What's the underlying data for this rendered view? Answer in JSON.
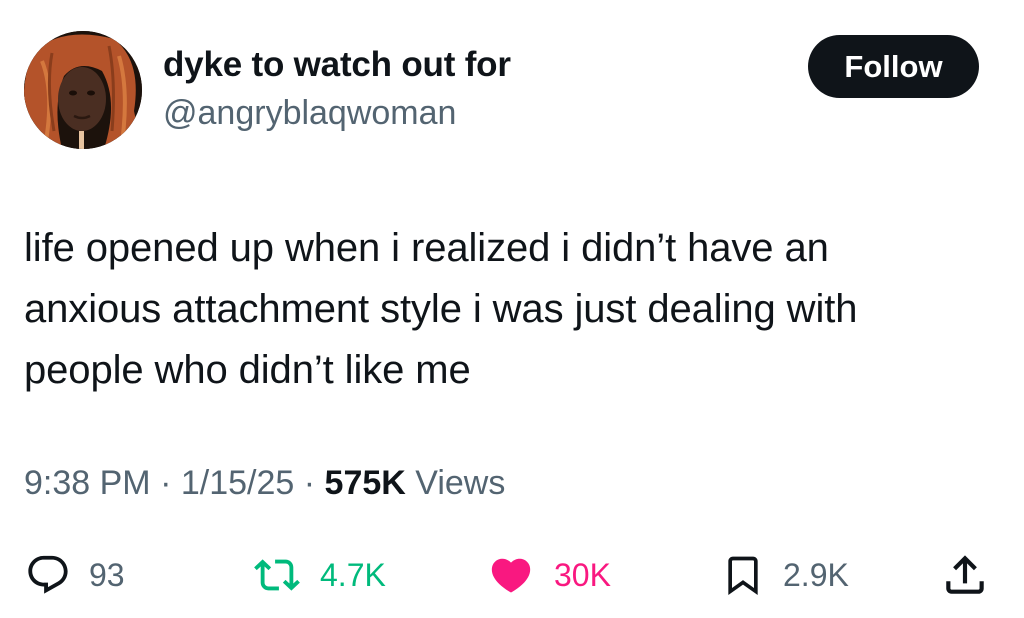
{
  "author": {
    "display_name": "dyke to watch out for",
    "handle": "@angryblaqwoman",
    "avatar_icon": "profile-photo"
  },
  "follow_button": {
    "label": "Follow"
  },
  "tweet": {
    "text_lines": [
      "life opened up when i realized i didn’t have an",
      "anxious attachment style i was just dealing with",
      "people who didn’t like me"
    ]
  },
  "meta": {
    "time": "9:38 PM",
    "separator": "·",
    "date": "1/15/25",
    "views_count": "575K",
    "views_label": "Views"
  },
  "actions": {
    "reply": {
      "icon": "reply-icon",
      "count": "93"
    },
    "retweet": {
      "icon": "retweet-icon",
      "count": "4.7K",
      "color": "#00ba7c"
    },
    "like": {
      "icon": "heart-icon",
      "count": "30K",
      "color": "#f91880"
    },
    "bookmark": {
      "icon": "bookmark-icon",
      "count": "2.9K"
    },
    "share": {
      "icon": "share-icon"
    }
  },
  "colors": {
    "text_primary": "#0f1419",
    "text_secondary": "#536471",
    "button_bg": "#0f1419"
  }
}
